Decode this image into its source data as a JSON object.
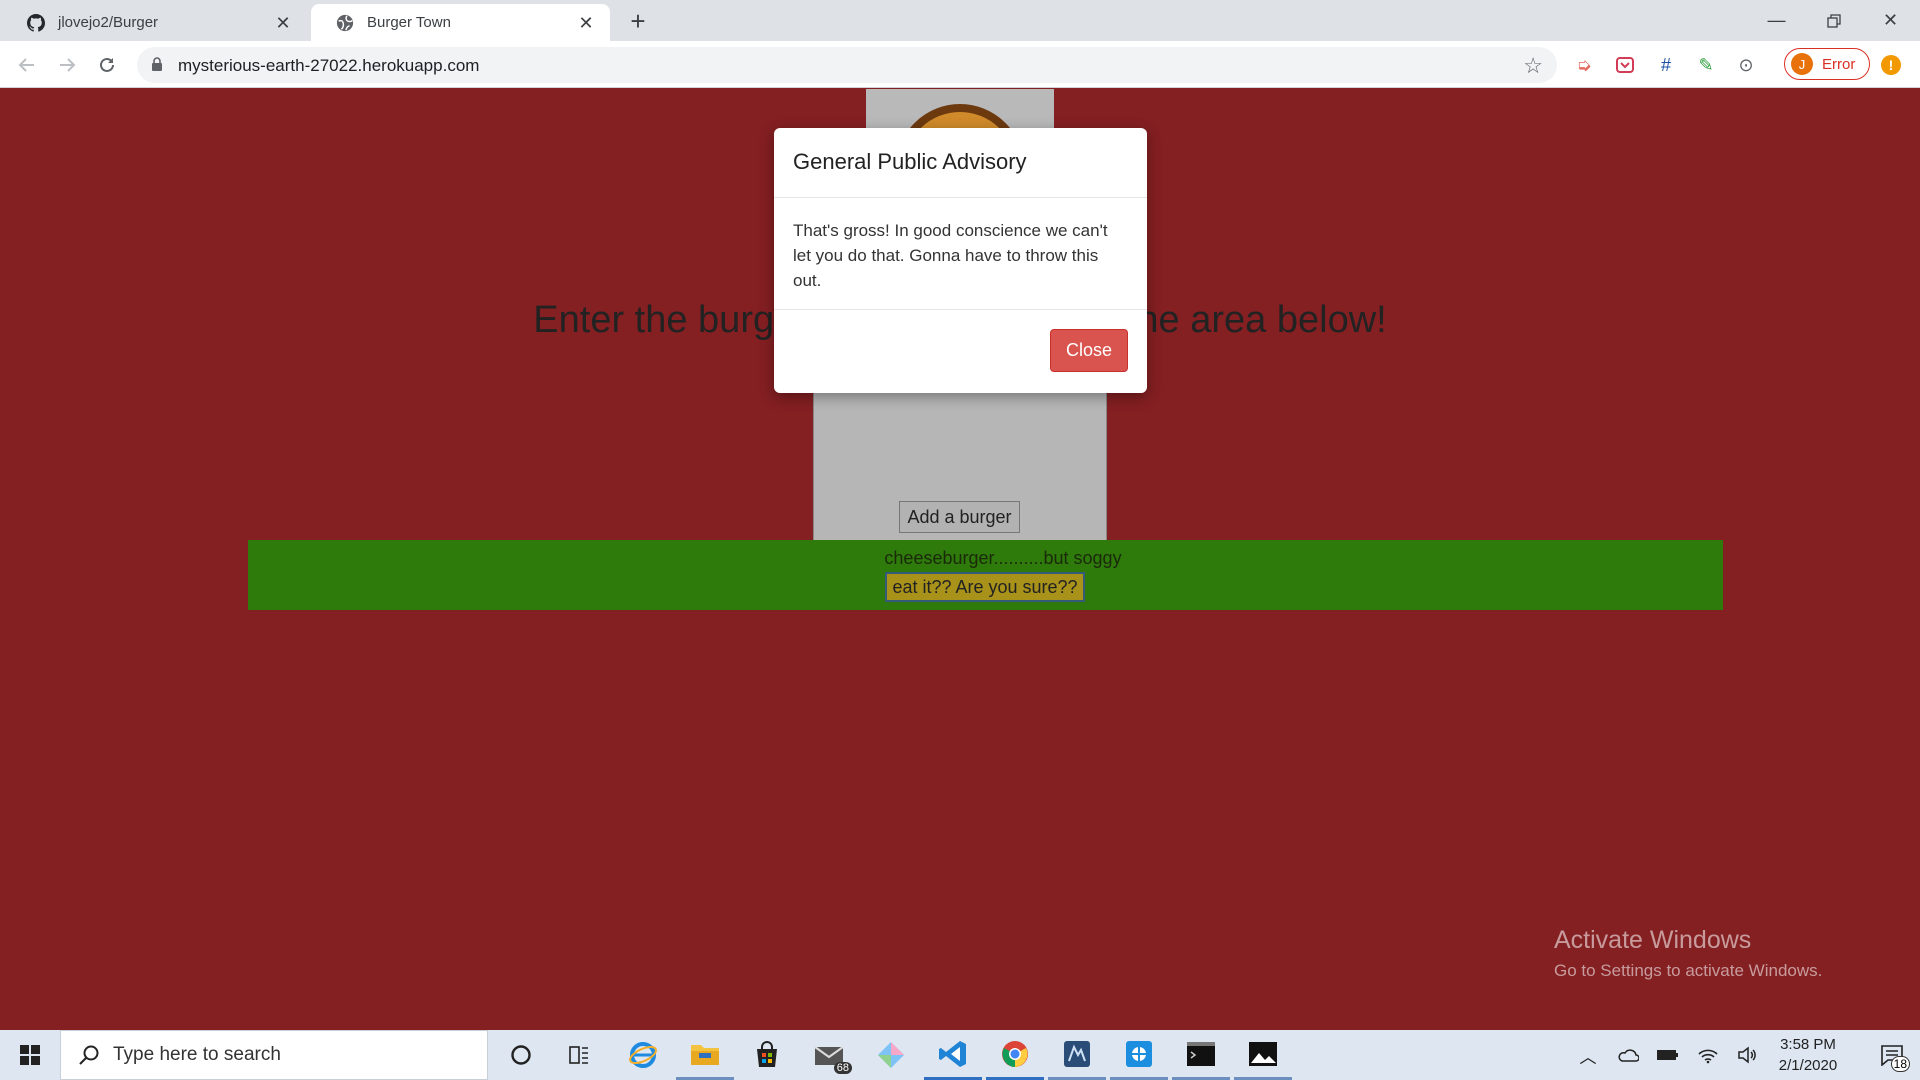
{
  "browser": {
    "tabs": [
      {
        "title": "jlovejo2/Burger",
        "favicon": "github-icon"
      },
      {
        "title": "Burger Town",
        "favicon": "globe-icon",
        "active": true
      }
    ],
    "url": "mysterious-earth-27022.herokuapp.com",
    "profile_initial": "J",
    "profile_status": "Error",
    "update_badge": "!"
  },
  "page": {
    "headline": "Enter the burger you want to eat in the area below!",
    "add_button_label": "Add a burger",
    "burgers": [
      {
        "name": "cheeseburger..........but soggy",
        "action_label": "eat it?? Are you sure??"
      }
    ]
  },
  "modal": {
    "title": "General Public Advisory",
    "body": "That's gross! In good conscience we can't let you do that. Gonna have to throw this out.",
    "close_label": "Close"
  },
  "watermark": {
    "line1": "Activate Windows",
    "line2": "Go to Settings to activate Windows."
  },
  "taskbar": {
    "search_placeholder": "Type here to search",
    "mail_badge": "68",
    "time": "3:58 PM",
    "date": "2/1/2020",
    "notifications": "18"
  },
  "colors": {
    "page_bg": "#841f22",
    "burger_bar": "#2e7a0a",
    "close_button": "#d9534f",
    "eat_button": "#a99219"
  }
}
